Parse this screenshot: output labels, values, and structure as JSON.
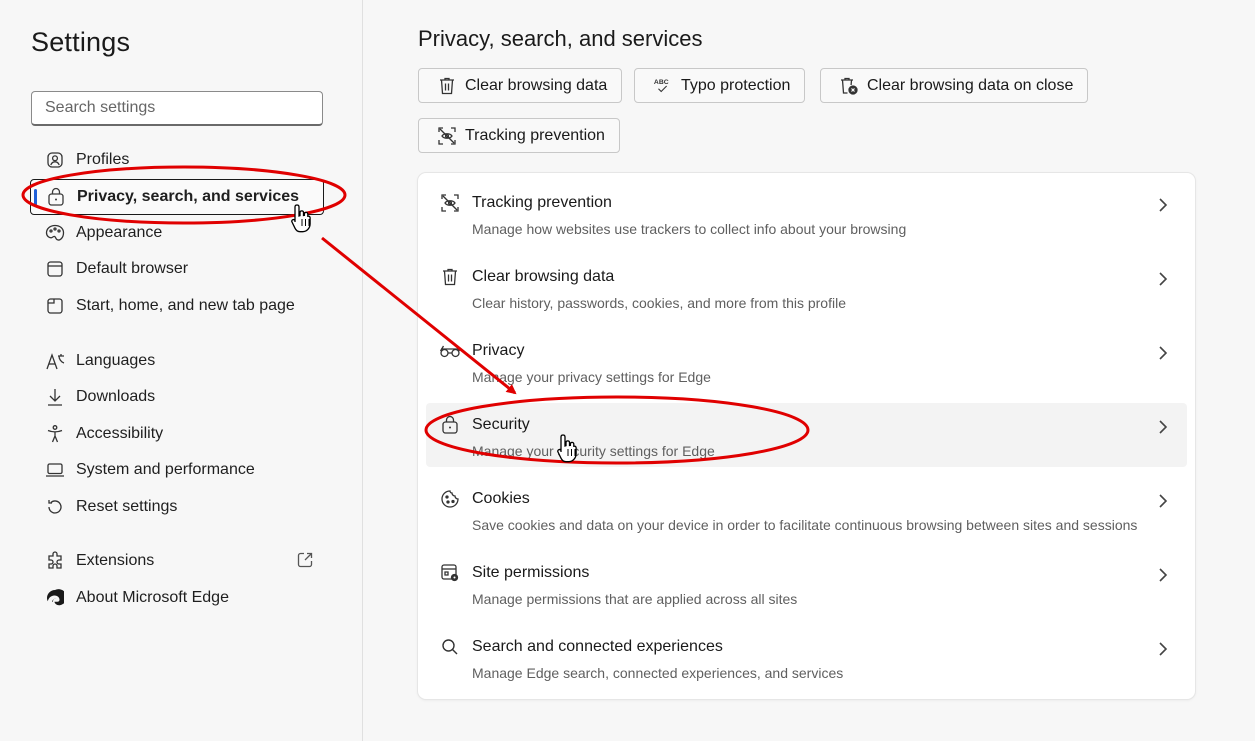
{
  "sidebar": {
    "title": "Settings",
    "search_placeholder": "Search settings",
    "items": [
      {
        "label": "Profiles",
        "icon": "profile-icon"
      },
      {
        "label": "Privacy, search, and services",
        "icon": "lock-icon",
        "active": true
      },
      {
        "label": "Appearance",
        "icon": "palette-icon"
      },
      {
        "label": "Default browser",
        "icon": "browser-icon"
      },
      {
        "label": "Start, home, and new tab page",
        "icon": "home-tab-icon"
      },
      {
        "label": "Languages",
        "icon": "languages-icon"
      },
      {
        "label": "Downloads",
        "icon": "download-icon"
      },
      {
        "label": "Accessibility",
        "icon": "accessibility-icon"
      },
      {
        "label": "System and performance",
        "icon": "laptop-icon"
      },
      {
        "label": "Reset settings",
        "icon": "reset-icon"
      },
      {
        "label": "Extensions",
        "icon": "puzzle-icon"
      },
      {
        "label": "About Microsoft Edge",
        "icon": "edge-logo-icon"
      }
    ]
  },
  "main": {
    "title": "Privacy, search, and services",
    "chips": [
      {
        "label": "Clear browsing data",
        "icon": "trash-icon"
      },
      {
        "label": "Typo protection",
        "icon": "abc-check-icon"
      },
      {
        "label": "Clear browsing data on close",
        "icon": "trash-clock-icon"
      },
      {
        "label": "Tracking prevention",
        "icon": "tracking-icon"
      }
    ],
    "rows": [
      {
        "title": "Tracking prevention",
        "subtitle": "Manage how websites use trackers to collect info about your browsing",
        "icon": "tracking-icon"
      },
      {
        "title": "Clear browsing data",
        "subtitle": "Clear history, passwords, cookies, and more from this profile",
        "icon": "trash-icon"
      },
      {
        "title": "Privacy",
        "subtitle": "Manage your privacy settings for Edge",
        "icon": "glasses-icon"
      },
      {
        "title": "Security",
        "subtitle": "Manage your security settings for Edge",
        "icon": "lock-icon"
      },
      {
        "title": "Cookies",
        "subtitle": "Save cookies and data on your device in order to facilitate continuous browsing between sites and sessions",
        "icon": "cookie-icon"
      },
      {
        "title": "Site permissions",
        "subtitle": "Manage permissions that are applied across all sites",
        "icon": "site-permissions-icon"
      },
      {
        "title": "Search and connected experiences",
        "subtitle": "Manage Edge search, connected experiences, and services",
        "icon": "search-icon"
      }
    ]
  },
  "colors": {
    "annotation": "#e00000",
    "accent": "#1f5fd8"
  }
}
